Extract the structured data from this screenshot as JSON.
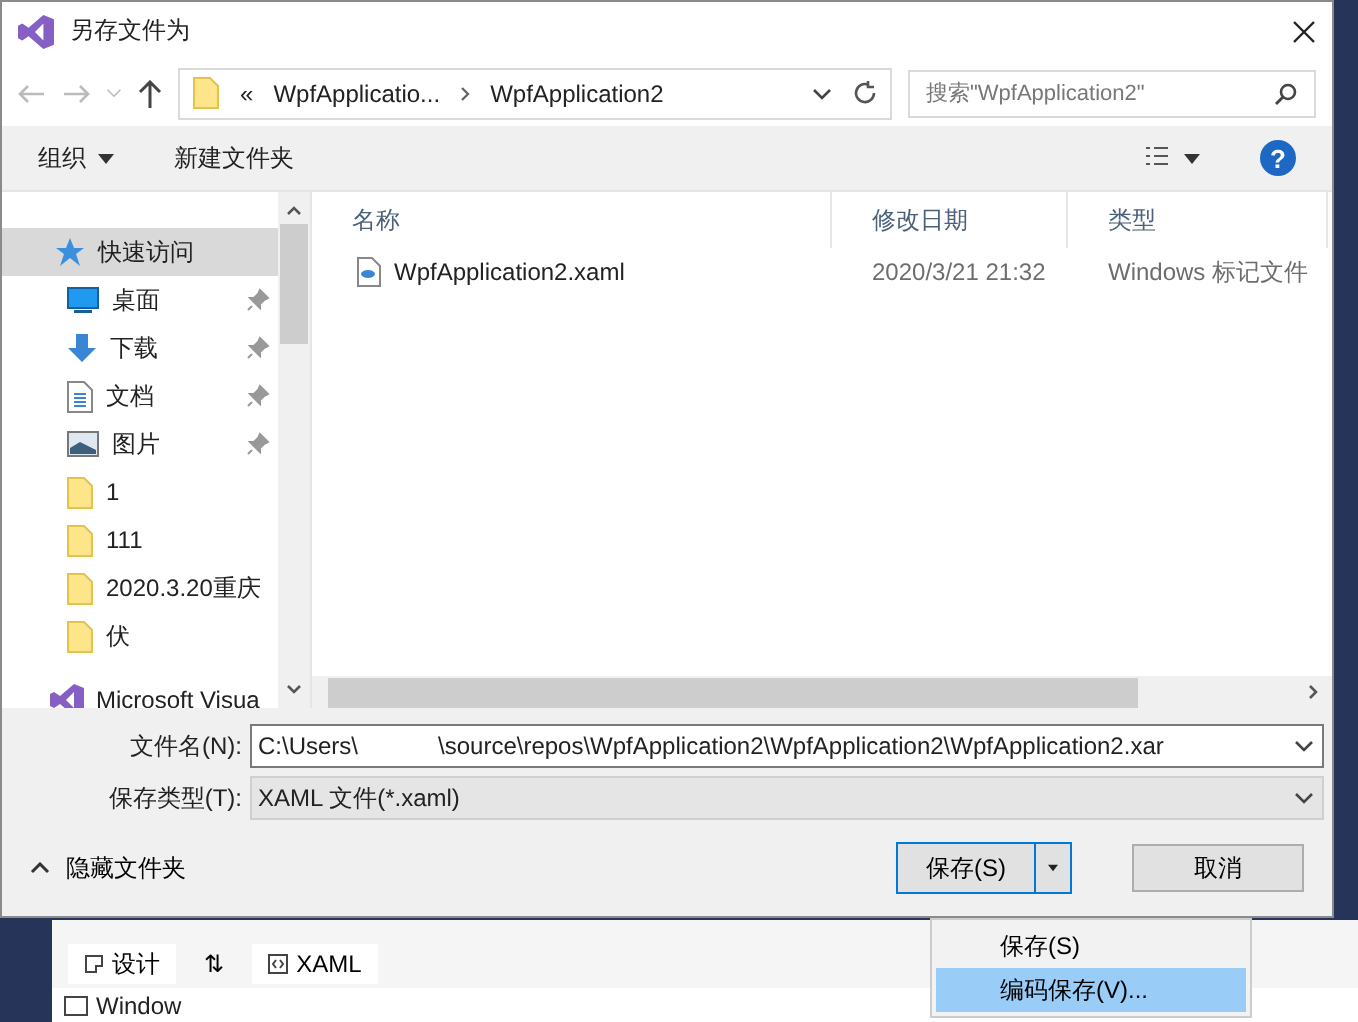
{
  "window": {
    "title": "另存文件为"
  },
  "nav": {
    "path": [
      {
        "label": "«"
      },
      {
        "label": "WpfApplicatio..."
      },
      {
        "label": "WpfApplication2"
      }
    ],
    "search": {
      "placeholder": "搜索\"WpfApplication2\""
    }
  },
  "toolbar": {
    "organize": "组织",
    "new_folder": "新建文件夹",
    "help": "?"
  },
  "sidebar": {
    "items": [
      {
        "label": "快速访问",
        "kind": "quick",
        "selected": true,
        "pinned": false
      },
      {
        "label": "桌面",
        "kind": "desktop",
        "selected": false,
        "pinned": true
      },
      {
        "label": "下载",
        "kind": "download",
        "selected": false,
        "pinned": true
      },
      {
        "label": "文档",
        "kind": "document",
        "selected": false,
        "pinned": true
      },
      {
        "label": "图片",
        "kind": "pictures",
        "selected": false,
        "pinned": true
      },
      {
        "label": "1",
        "kind": "folder",
        "selected": false,
        "pinned": false
      },
      {
        "label": "111",
        "kind": "folder",
        "selected": false,
        "pinned": false
      },
      {
        "label": "2020.3.20重庆",
        "kind": "folder",
        "selected": false,
        "pinned": false
      },
      {
        "label": "伏",
        "kind": "folder",
        "selected": false,
        "pinned": false
      },
      {
        "label": "Microsoft Visua",
        "kind": "vs",
        "selected": false,
        "pinned": false
      }
    ]
  },
  "table": {
    "columns": [
      "名称",
      "修改日期",
      "类型"
    ],
    "rows": [
      {
        "name": "WpfApplication2.xaml",
        "modified": "2020/3/21 21:32",
        "type": "Windows 标记文件"
      }
    ]
  },
  "form": {
    "file_name_label": "文件名(N):",
    "file_name_value": "C:\\Users\\            \\source\\repos\\WpfApplication2\\WpfApplication2\\WpfApplication2.xar",
    "file_type_label": "保存类型(T):",
    "file_type_value": "XAML 文件(*.xaml)"
  },
  "hide_folders": "隐藏文件夹",
  "buttons": {
    "save": "保存(S)",
    "cancel": "取消"
  },
  "save_menu": [
    {
      "label": "保存(S)",
      "selected": false
    },
    {
      "label": "编码保存(V)...",
      "selected": true
    }
  ],
  "background": {
    "tabs": [
      {
        "label": "设计",
        "kind": "design"
      },
      {
        "label": "⇅",
        "kind": "swap"
      },
      {
        "label": "XAML",
        "kind": "xaml"
      }
    ],
    "element": "Window"
  }
}
